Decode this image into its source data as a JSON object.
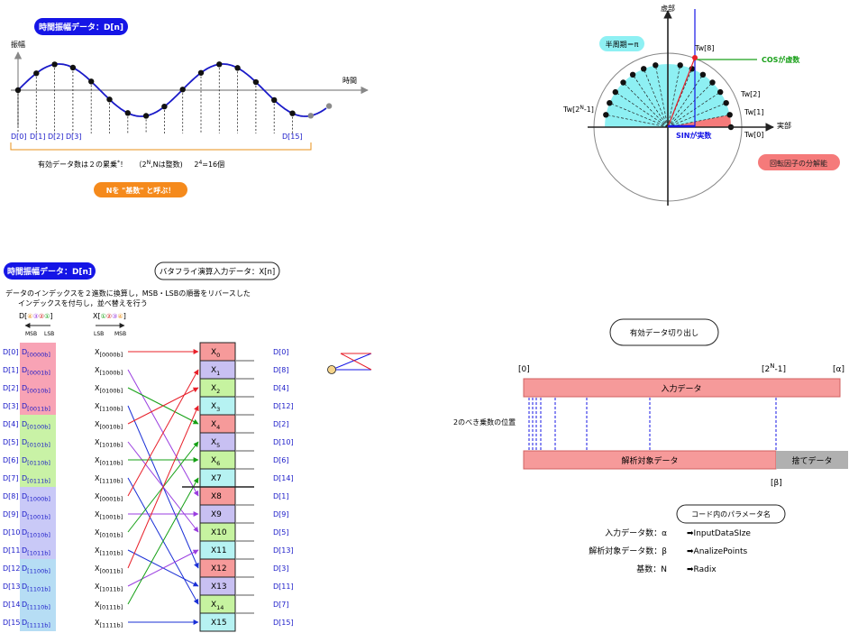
{
  "wave": {
    "title": "時間振幅データ：D[n]",
    "y_label": "振幅",
    "x_label": "時間",
    "labels": [
      "D[0]",
      "D[1]",
      "D[2]",
      "D[3]",
      "D[15]"
    ],
    "note_pre": "有効データ数は２の累乗",
    "note_star": "*",
    "note_mark": "！",
    "note_paren1": "（2",
    "note_paren_sup": "N",
    "note_paren2": ",Nは整数)",
    "note_example": "2",
    "note_example_sup": "4",
    "note_example2": "=16個",
    "base_label": "Nを \"基数\" と呼ぶ！"
  },
  "unit_circle": {
    "imag_label": "虚部",
    "real_label": "実部",
    "half_period": "半周期＝π",
    "cos_label": "COSが虚数",
    "sin_label": "SINが実数",
    "tw8": "Tw[8]",
    "tw2": "Tw[2]",
    "tw1": "Tw[1]",
    "tw0": "Tw[0]",
    "twN_pre": "Tw[2",
    "twN_sup": "N",
    "twN_post": "-1]",
    "rotation": "回転因子の分解能"
  },
  "butterfly": {
    "title": "時間振幅データ：D[n]",
    "input_label": "バタフライ演算入力データ：X[n]",
    "desc1": "データのインデックスを２進数に換算し，MSB・LSBの順番をリバースした",
    "desc2": "インデックスを付与し，並べ替えを行う",
    "d_label": "D",
    "x_label": "X",
    "bit_open": "[",
    "bit_close": "]",
    "bits_d": [
      "④",
      "③",
      "②",
      "①"
    ],
    "bits_x": [
      "①",
      "②",
      "③",
      "④"
    ],
    "msb": "MSB",
    "lsb": "LSB",
    "left_index": [
      "D[0]",
      "D[1]",
      "D[2]",
      "D[3]",
      "D[4]",
      "D[5]",
      "D[6]",
      "D[7]",
      "D[8]",
      "D[9]",
      "D[10]",
      "D[11]",
      "D[12]",
      "D[13]",
      "D[14]",
      "D[15]"
    ],
    "d_binary": [
      "[0000b]",
      "[0001b]",
      "[0010b]",
      "[0011b]",
      "[0100b]",
      "[0101b]",
      "[0110b]",
      "[0111b]",
      "[1000b]",
      "[1001b]",
      "[1010b]",
      "[1011b]",
      "[1100b]",
      "[1101b]",
      "[1110b]",
      "[1111b]"
    ],
    "x_binary": [
      "[0000b]",
      "[1000b]",
      "[0100b]",
      "[1100b]",
      "[0010b]",
      "[1010b]",
      "[0110b]",
      "[1110b]",
      "[0001b]",
      "[1001b]",
      "[0101b]",
      "[1101b]",
      "[0011b]",
      "[1011b]",
      "[0111b]",
      "[1111b]"
    ],
    "boxes": [
      {
        "main": "X",
        "sub": "0"
      },
      {
        "main": "X",
        "sub": "1"
      },
      {
        "main": "X",
        "sub": "2"
      },
      {
        "main": "X",
        "sub": "3"
      },
      {
        "main": "X",
        "sub": "4"
      },
      {
        "main": "X",
        "sub": "5"
      },
      {
        "main": "X",
        "sub": "6"
      },
      {
        "main": "X7",
        "sub": ""
      },
      {
        "main": "X8",
        "sub": ""
      },
      {
        "main": "X9",
        "sub": ""
      },
      {
        "main": "X10",
        "sub": ""
      },
      {
        "main": "X11",
        "sub": ""
      },
      {
        "main": "X12",
        "sub": ""
      },
      {
        "main": "X13",
        "sub": ""
      },
      {
        "main": "X",
        "sub": "14"
      },
      {
        "main": "X15",
        "sub": ""
      }
    ],
    "right_index": [
      "D[0]",
      "D[8]",
      "D[4]",
      "D[12]",
      "D[2]",
      "D[10]",
      "D[6]",
      "D[14]",
      "D[1]",
      "D[9]",
      "D[5]",
      "D[13]",
      "D[3]",
      "D[11]",
      "D[7]",
      "D[15]"
    ],
    "sources": [
      0,
      8,
      4,
      12,
      2,
      10,
      6,
      14,
      1,
      9,
      5,
      13,
      3,
      11,
      7,
      15
    ],
    "group_colors": [
      "#f8a3b5",
      "#c9f2a6",
      "#c9c9f7",
      "#b6ddf4"
    ],
    "box_colors": [
      "#f69a9a",
      "#c8c0f2",
      "#c6f3a0",
      "#b6f2f2"
    ],
    "line_colors": [
      "#e8202a",
      "#9a3de0",
      "#14a014",
      "#1a2fd6"
    ]
  },
  "valid_data": {
    "title": "有効データ切り出し",
    "idx0": "[0]",
    "idxN_pre": "[2",
    "idxN_sup": "N",
    "idxN_post": "-1]",
    "idx_alpha": "[α]",
    "idx_beta": "[β]",
    "input_bar": "入力データ",
    "analysis_bar": "解析対象データ",
    "discard_bar": "捨てデータ",
    "power_pos": "2のべき乗数の位置",
    "params_title": "コード内のパラメータ名",
    "params": [
      {
        "label": "入力データ数：α",
        "value": "➡InputDataSIze"
      },
      {
        "label": "解析対象データ数：β",
        "value": "➡AnalizePoints"
      },
      {
        "label": "基数：N",
        "value": "➡Radix"
      }
    ]
  }
}
